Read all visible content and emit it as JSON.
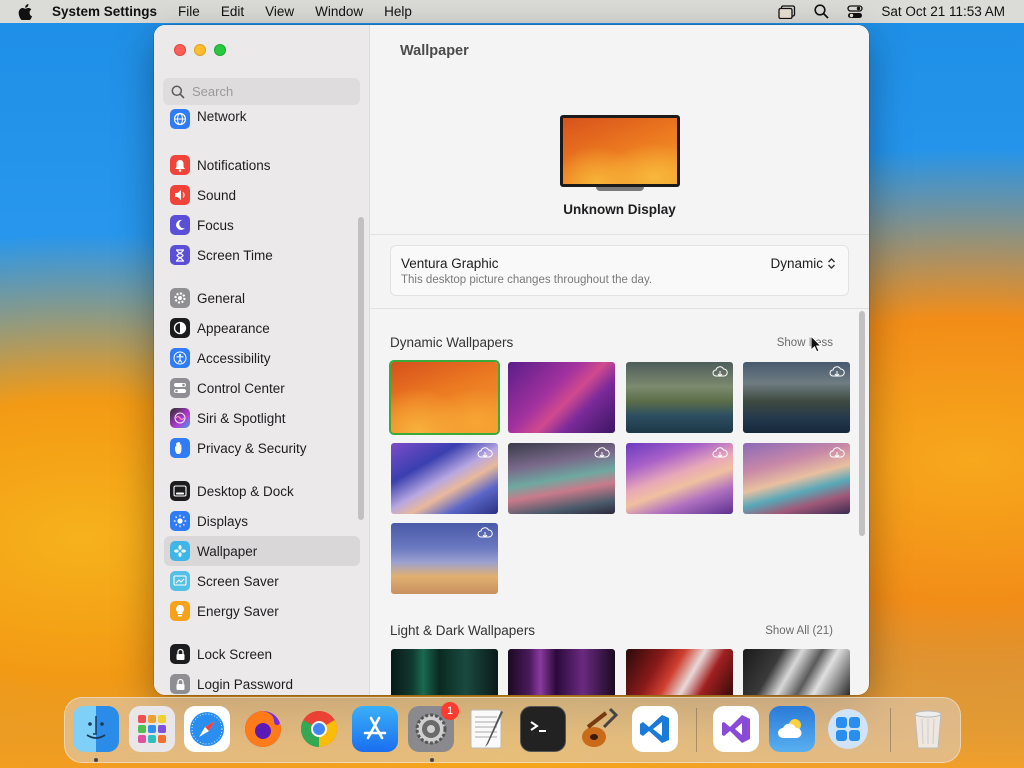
{
  "menubar": {
    "app_name": "System Settings",
    "menus": [
      "File",
      "Edit",
      "View",
      "Window",
      "Help"
    ],
    "clock": "Sat Oct 21  11:53 AM"
  },
  "search": {
    "placeholder": "Search"
  },
  "sidebar": {
    "items": [
      {
        "label": "Network",
        "icon": "globe-icon",
        "color": "#2f7cf6"
      },
      {
        "label": "Notifications",
        "icon": "bell-icon",
        "color": "#f0443a"
      },
      {
        "label": "Sound",
        "icon": "speaker-icon",
        "color": "#f0443a"
      },
      {
        "label": "Focus",
        "icon": "moon-icon",
        "color": "#5b4fd8"
      },
      {
        "label": "Screen Time",
        "icon": "hourglass-icon",
        "color": "#5b4fd8"
      },
      {
        "label": "General",
        "icon": "gear-icon",
        "color": "#8e8e93"
      },
      {
        "label": "Appearance",
        "icon": "appearance-icon",
        "color": "#1c1c1e"
      },
      {
        "label": "Accessibility",
        "icon": "accessibility-icon",
        "color": "#2f7cf6"
      },
      {
        "label": "Control Center",
        "icon": "toggles-icon",
        "color": "#8e8e93"
      },
      {
        "label": "Siri & Spotlight",
        "icon": "siri-icon",
        "color": "#b33ad1"
      },
      {
        "label": "Privacy & Security",
        "icon": "hand-icon",
        "color": "#2f7cf6"
      },
      {
        "label": "Desktop & Dock",
        "icon": "dock-icon",
        "color": "#1c1c1e"
      },
      {
        "label": "Displays",
        "icon": "sun-icon",
        "color": "#2f7cf6"
      },
      {
        "label": "Wallpaper",
        "icon": "flower-icon",
        "color": "#3fb5e8"
      },
      {
        "label": "Screen Saver",
        "icon": "screensaver-icon",
        "color": "#55c0e6"
      },
      {
        "label": "Energy Saver",
        "icon": "bulb-icon",
        "color": "#f7a21b"
      },
      {
        "label": "Lock Screen",
        "icon": "lock-icon",
        "color": "#1c1c1e"
      },
      {
        "label": "Login Password",
        "icon": "lock-icon",
        "color": "#8e8e93"
      }
    ]
  },
  "main": {
    "title": "Wallpaper",
    "display_name": "Unknown Display",
    "current": {
      "name": "Ventura Graphic",
      "description": "This desktop picture changes throughout the day.",
      "mode": "Dynamic"
    },
    "dynamic_section": {
      "title": "Dynamic Wallpapers",
      "link": "Show Less"
    },
    "light_dark_section": {
      "title": "Light & Dark Wallpapers",
      "link": "Show All (21)"
    }
  },
  "dock": {
    "apps": [
      "Finder",
      "Launchpad",
      "Safari",
      "Firefox",
      "Chrome",
      "App Store",
      "System Settings",
      "TextEdit",
      "Terminal",
      "Instruments",
      "VS Code",
      "Visual Studio",
      "Weather",
      "Microsoft 365",
      "Trash"
    ],
    "settings_badge": "1"
  }
}
